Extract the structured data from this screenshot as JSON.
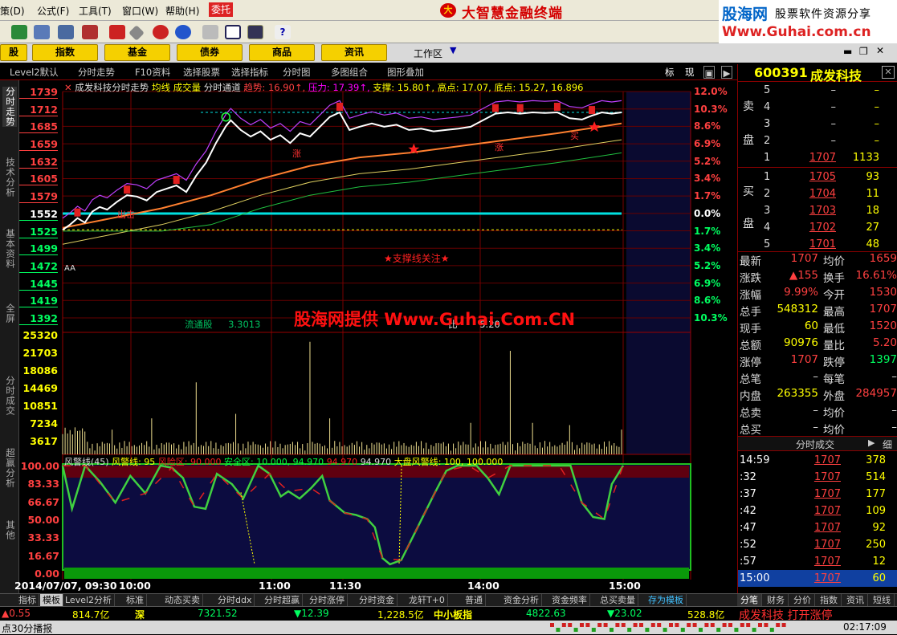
{
  "menu": {
    "items": [
      "策(D)",
      "公式(F)",
      "工具(T)",
      "窗口(W)",
      "帮助(H)"
    ],
    "entrust": "委托",
    "app_title": "大智慧金融终端"
  },
  "watermark": {
    "logo": "股海网",
    "slogan": "股票软件资源分享",
    "url": "Www.Guhai.com.cn",
    "overlay": "股海网提供 Www.Guhai.Com.CN"
  },
  "funcbar": {
    "buttons": [
      "股",
      "指数",
      "基金",
      "债券",
      "商品",
      "资讯"
    ],
    "workspace": "工作区"
  },
  "tabs": [
    "Level2默认",
    "分时走势",
    "F10资料",
    "选择股票",
    "选择指标",
    "分时图",
    "多图组合",
    "图形叠加"
  ],
  "tabs_right": [
    "标",
    "现"
  ],
  "left_tabs": [
    "分时走势",
    "技术分析",
    "基本资料",
    "全屏",
    "分时成交",
    "超赢分析",
    "其他"
  ],
  "stock": {
    "code": "600391",
    "name": "成发科技"
  },
  "chart_data": {
    "type": "line",
    "title": "成发科技分时走势",
    "info": {
      "items": [
        "均线",
        "成交量",
        "分时通道"
      ],
      "trend_label": "趋势",
      "trend": "16.90",
      "pressure_label": "压力",
      "pressure": "17.39",
      "support_label": "支撑",
      "support": "15.80",
      "high_label": "高点",
      "high": "17.07",
      "low_label": "底点",
      "low": "15.27, 16.896"
    },
    "price_ticks": [
      "1739",
      "1712",
      "1685",
      "1659",
      "1632",
      "1605",
      "1579",
      "1552",
      "1525",
      "1499",
      "1472",
      "1445",
      "1419",
      "1392"
    ],
    "pct_ticks": [
      "12.0%",
      "10.3%",
      "8.6%",
      "6.9%",
      "5.2%",
      "3.4%",
      "1.7%",
      "0.0%",
      "1.7%",
      "3.4%",
      "5.2%",
      "6.9%",
      "8.6%",
      "10.3%"
    ],
    "prev_close": 15.52,
    "ylim": [
      13.92,
      17.39
    ],
    "x_ticks": [
      "2014/07/07, 09:30",
      "10:00",
      "11:00",
      "11:30",
      "14:00",
      "15:00"
    ],
    "price": [
      [
        0,
        15.27
      ],
      [
        3,
        15.35
      ],
      [
        6,
        15.45
      ],
      [
        9,
        15.38
      ],
      [
        12,
        15.55
      ],
      [
        15,
        15.62
      ],
      [
        18,
        15.58
      ],
      [
        22,
        15.7
      ],
      [
        26,
        15.8
      ],
      [
        30,
        15.78
      ],
      [
        34,
        15.72
      ],
      [
        38,
        15.85
      ],
      [
        42,
        15.9
      ],
      [
        46,
        15.95
      ],
      [
        50,
        15.85
      ],
      [
        54,
        16.1
      ],
      [
        58,
        16.3
      ],
      [
        62,
        16.6
      ],
      [
        66,
        16.86
      ],
      [
        68,
        16.95
      ],
      [
        72,
        16.8
      ],
      [
        76,
        16.7
      ],
      [
        80,
        16.78
      ],
      [
        84,
        16.65
      ],
      [
        88,
        16.72
      ],
      [
        92,
        16.6
      ],
      [
        96,
        16.75
      ],
      [
        100,
        16.7
      ],
      [
        104,
        16.85
      ],
      [
        108,
        17.0
      ],
      [
        112,
        17.07
      ],
      [
        116,
        16.8
      ],
      [
        120,
        16.85
      ],
      [
        125,
        16.9
      ],
      [
        130,
        16.85
      ],
      [
        135,
        16.88
      ],
      [
        140,
        16.8
      ],
      [
        145,
        16.82
      ],
      [
        150,
        16.78
      ],
      [
        155,
        16.8
      ],
      [
        160,
        16.82
      ],
      [
        165,
        16.85
      ],
      [
        170,
        16.95
      ],
      [
        175,
        17.05
      ],
      [
        180,
        17.07
      ],
      [
        185,
        17.05
      ],
      [
        190,
        17.07
      ],
      [
        195,
        17.06
      ],
      [
        200,
        17.07
      ],
      [
        205,
        16.98
      ],
      [
        210,
        16.96
      ],
      [
        214,
        17.02
      ],
      [
        218,
        17.07
      ],
      [
        222,
        17.05
      ],
      [
        226,
        17.07
      ]
    ],
    "avg": [
      [
        0,
        15.3
      ],
      [
        20,
        15.45
      ],
      [
        40,
        15.6
      ],
      [
        60,
        15.8
      ],
      [
        80,
        16.05
      ],
      [
        100,
        16.25
      ],
      [
        120,
        16.38
      ],
      [
        140,
        16.45
      ],
      [
        160,
        16.55
      ],
      [
        180,
        16.65
      ],
      [
        200,
        16.75
      ],
      [
        226,
        16.9
      ]
    ],
    "volume_ticks": [
      "25320",
      "21703",
      "18086",
      "14469",
      "10851",
      "7234",
      "3617"
    ],
    "volume_info": {
      "label": "流通股",
      "value": "3.3013",
      "label2": "比",
      "value2": "5.20"
    },
    "vol_spikes": [
      [
        5,
        6000
      ],
      [
        20,
        5500
      ],
      [
        36,
        8000
      ],
      [
        54,
        16000
      ],
      [
        70,
        9000
      ],
      [
        100,
        25000
      ],
      [
        108,
        8000
      ],
      [
        165,
        7000
      ],
      [
        181,
        23000
      ],
      [
        190,
        7000
      ],
      [
        205,
        6500
      ],
      [
        226,
        5500
      ]
    ],
    "alert_info": {
      "name": "风警线(45)",
      "line_label": "风警线",
      "line": "95",
      "risk_label": "风险区",
      "risk": "90.000",
      "safe_label": "安全区",
      "safe": "10.000, 94.970",
      "v1": "94.970",
      "v2": "94.970",
      "market_label": "大盘风警线",
      "market1": "100",
      "market2": "100.000"
    },
    "alert_ticks": [
      "100.00",
      "83.33",
      "66.67",
      "50.00",
      "33.33",
      "16.67",
      "0.00"
    ],
    "support_note": "★支撑线关注★",
    "marks": {
      "rise": "涨",
      "buy": "买",
      "sell": "出击",
      "aa": "AA"
    }
  },
  "orderbook": {
    "sell_label": [
      "卖",
      "盘"
    ],
    "buy_label": [
      "买",
      "盘"
    ],
    "sell": [
      {
        "n": "5",
        "p": "–",
        "v": "–"
      },
      {
        "n": "4",
        "p": "–",
        "v": "–"
      },
      {
        "n": "3",
        "p": "–",
        "v": "–"
      },
      {
        "n": "2",
        "p": "–",
        "v": "–"
      },
      {
        "n": "1",
        "p": "1707",
        "v": "1133"
      }
    ],
    "buy": [
      {
        "n": "1",
        "p": "1705",
        "v": "93"
      },
      {
        "n": "2",
        "p": "1704",
        "v": "11"
      },
      {
        "n": "3",
        "p": "1703",
        "v": "18"
      },
      {
        "n": "4",
        "p": "1702",
        "v": "27"
      },
      {
        "n": "5",
        "p": "1701",
        "v": "48"
      }
    ]
  },
  "quote": [
    {
      "l": "最新",
      "v": "1707",
      "l2": "均价",
      "v2": "1659"
    },
    {
      "l": "涨跌",
      "v": "▲155",
      "l2": "换手",
      "v2": "16.61%"
    },
    {
      "l": "涨幅",
      "v": "9.99%",
      "l2": "今开",
      "v2": "1530"
    },
    {
      "l": "总手",
      "v": "548312",
      "l2": "最高",
      "v2": "1707"
    },
    {
      "l": "现手",
      "v": "60",
      "l2": "最低",
      "v2": "1520"
    },
    {
      "l": "总额",
      "v": "90976",
      "l2": "量比",
      "v2": "5.20"
    },
    {
      "l": "涨停",
      "v": "1707",
      "l2": "跌停",
      "v2": "1397"
    },
    {
      "l": "总笔",
      "v": "–",
      "l2": "每笔",
      "v2": "–"
    },
    {
      "l": "内盘",
      "v": "263355",
      "l2": "外盘",
      "v2": "284957"
    },
    {
      "l": "总卖",
      "v": "–",
      "l2": "均价",
      "v2": "–"
    },
    {
      "l": "总买",
      "v": "–",
      "l2": "均价",
      "v2": "–"
    }
  ],
  "trades_title": "分时成交",
  "trades_detail": "细",
  "trades": [
    {
      "t": "14:59",
      "p": "1707",
      "v": "378"
    },
    {
      "t": ":32",
      "p": "1707",
      "v": "514"
    },
    {
      "t": ":37",
      "p": "1707",
      "v": "177"
    },
    {
      "t": ":42",
      "p": "1707",
      "v": "109"
    },
    {
      "t": ":47",
      "p": "1707",
      "v": "92"
    },
    {
      "t": ":52",
      "p": "1707",
      "v": "250"
    },
    {
      "t": ":57",
      "p": "1707",
      "v": "12"
    },
    {
      "t": "15:00",
      "p": "1707",
      "v": "60"
    }
  ],
  "right_tabs": [
    "分笔",
    "财务",
    "分价",
    "指数",
    "资讯",
    "短线"
  ],
  "bottom_tabs": [
    "指标",
    "模板",
    "Level2分析",
    "标准",
    "动态买卖",
    "分时ddx",
    "分时超赢",
    "分时涨停",
    "分时资金",
    "龙轩T+0",
    "普通",
    "资金分析",
    "资金频率",
    "总买卖量",
    "存为模板"
  ],
  "status": {
    "v1": "▲0.55",
    "v2": "814.7亿",
    "v3": "深",
    "v4": "7321.52",
    "v5": "▼12.39",
    "v6": "1,228.5亿",
    "v7": "中小板指",
    "v8": "4822.63",
    "v9": "▼23.02",
    "v10": "528.8亿",
    "ticker": "成发科技 打开涨停"
  },
  "status2": {
    "left": "点30分播报",
    "time": "02:17:09"
  }
}
